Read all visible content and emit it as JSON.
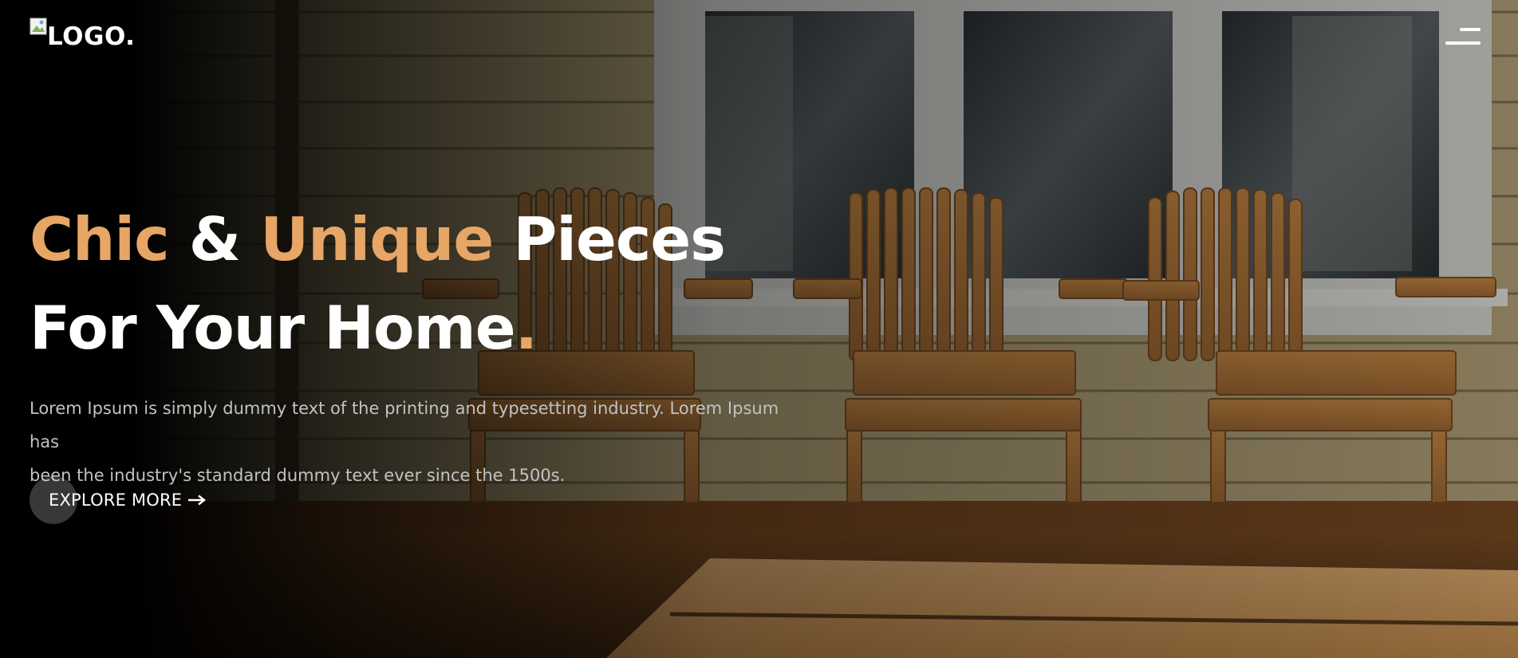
{
  "header": {
    "logo_text": "LOGO.",
    "menu_icon": "hamburger-menu-icon"
  },
  "hero": {
    "title": {
      "line1": {
        "word1": "Chic",
        "amp": "&",
        "word2": "Unique",
        "word3": "Pieces"
      },
      "line2": {
        "text": "For Your Home",
        "period": "."
      }
    },
    "description_line1": "Lorem Ipsum is simply dummy text of the printing and typesetting industry. Lorem Ipsum has",
    "description_line2": "been the industry's standard dummy text ever since the 1500s.",
    "cta_label": "EXPLORE MORE",
    "cta_icon": "arrow-right-icon",
    "background_image": "porch-adirondack-chairs-photo"
  },
  "colors": {
    "accent": "#e7a665",
    "text": "#ffffff",
    "muted_text": "#c2c2c2",
    "background": "#000000"
  }
}
